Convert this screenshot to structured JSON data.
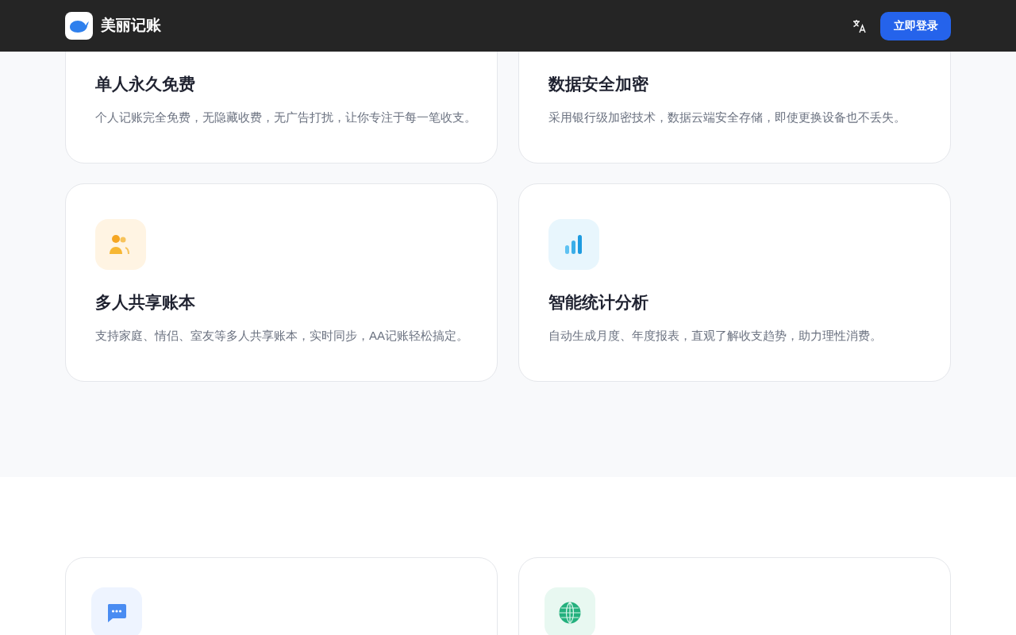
{
  "header": {
    "app_name": "美丽记账",
    "login_button": "立即登录"
  },
  "feature_cards": [
    {
      "title": "单人永久免费",
      "description": "个人记账完全免费，无隐藏收费，无广告打扰，让你专注于每一笔收支。"
    },
    {
      "title": "数据安全加密",
      "description": "采用银行级加密技术，数据云端安全存储，即使更换设备也不丢失。"
    },
    {
      "kind": "people",
      "title": "多人共享账本",
      "description": "支持家庭、情侣、室友等多人共享账本，实时同步，AA记账轻松搞定。"
    },
    {
      "kind": "chart",
      "title": "智能统计分析",
      "description": "自动生成月度、年度报表，直观了解收支趋势，助力理性消费。"
    }
  ],
  "more_cards": [
    {
      "kind": "chat"
    },
    {
      "kind": "globe"
    }
  ]
}
